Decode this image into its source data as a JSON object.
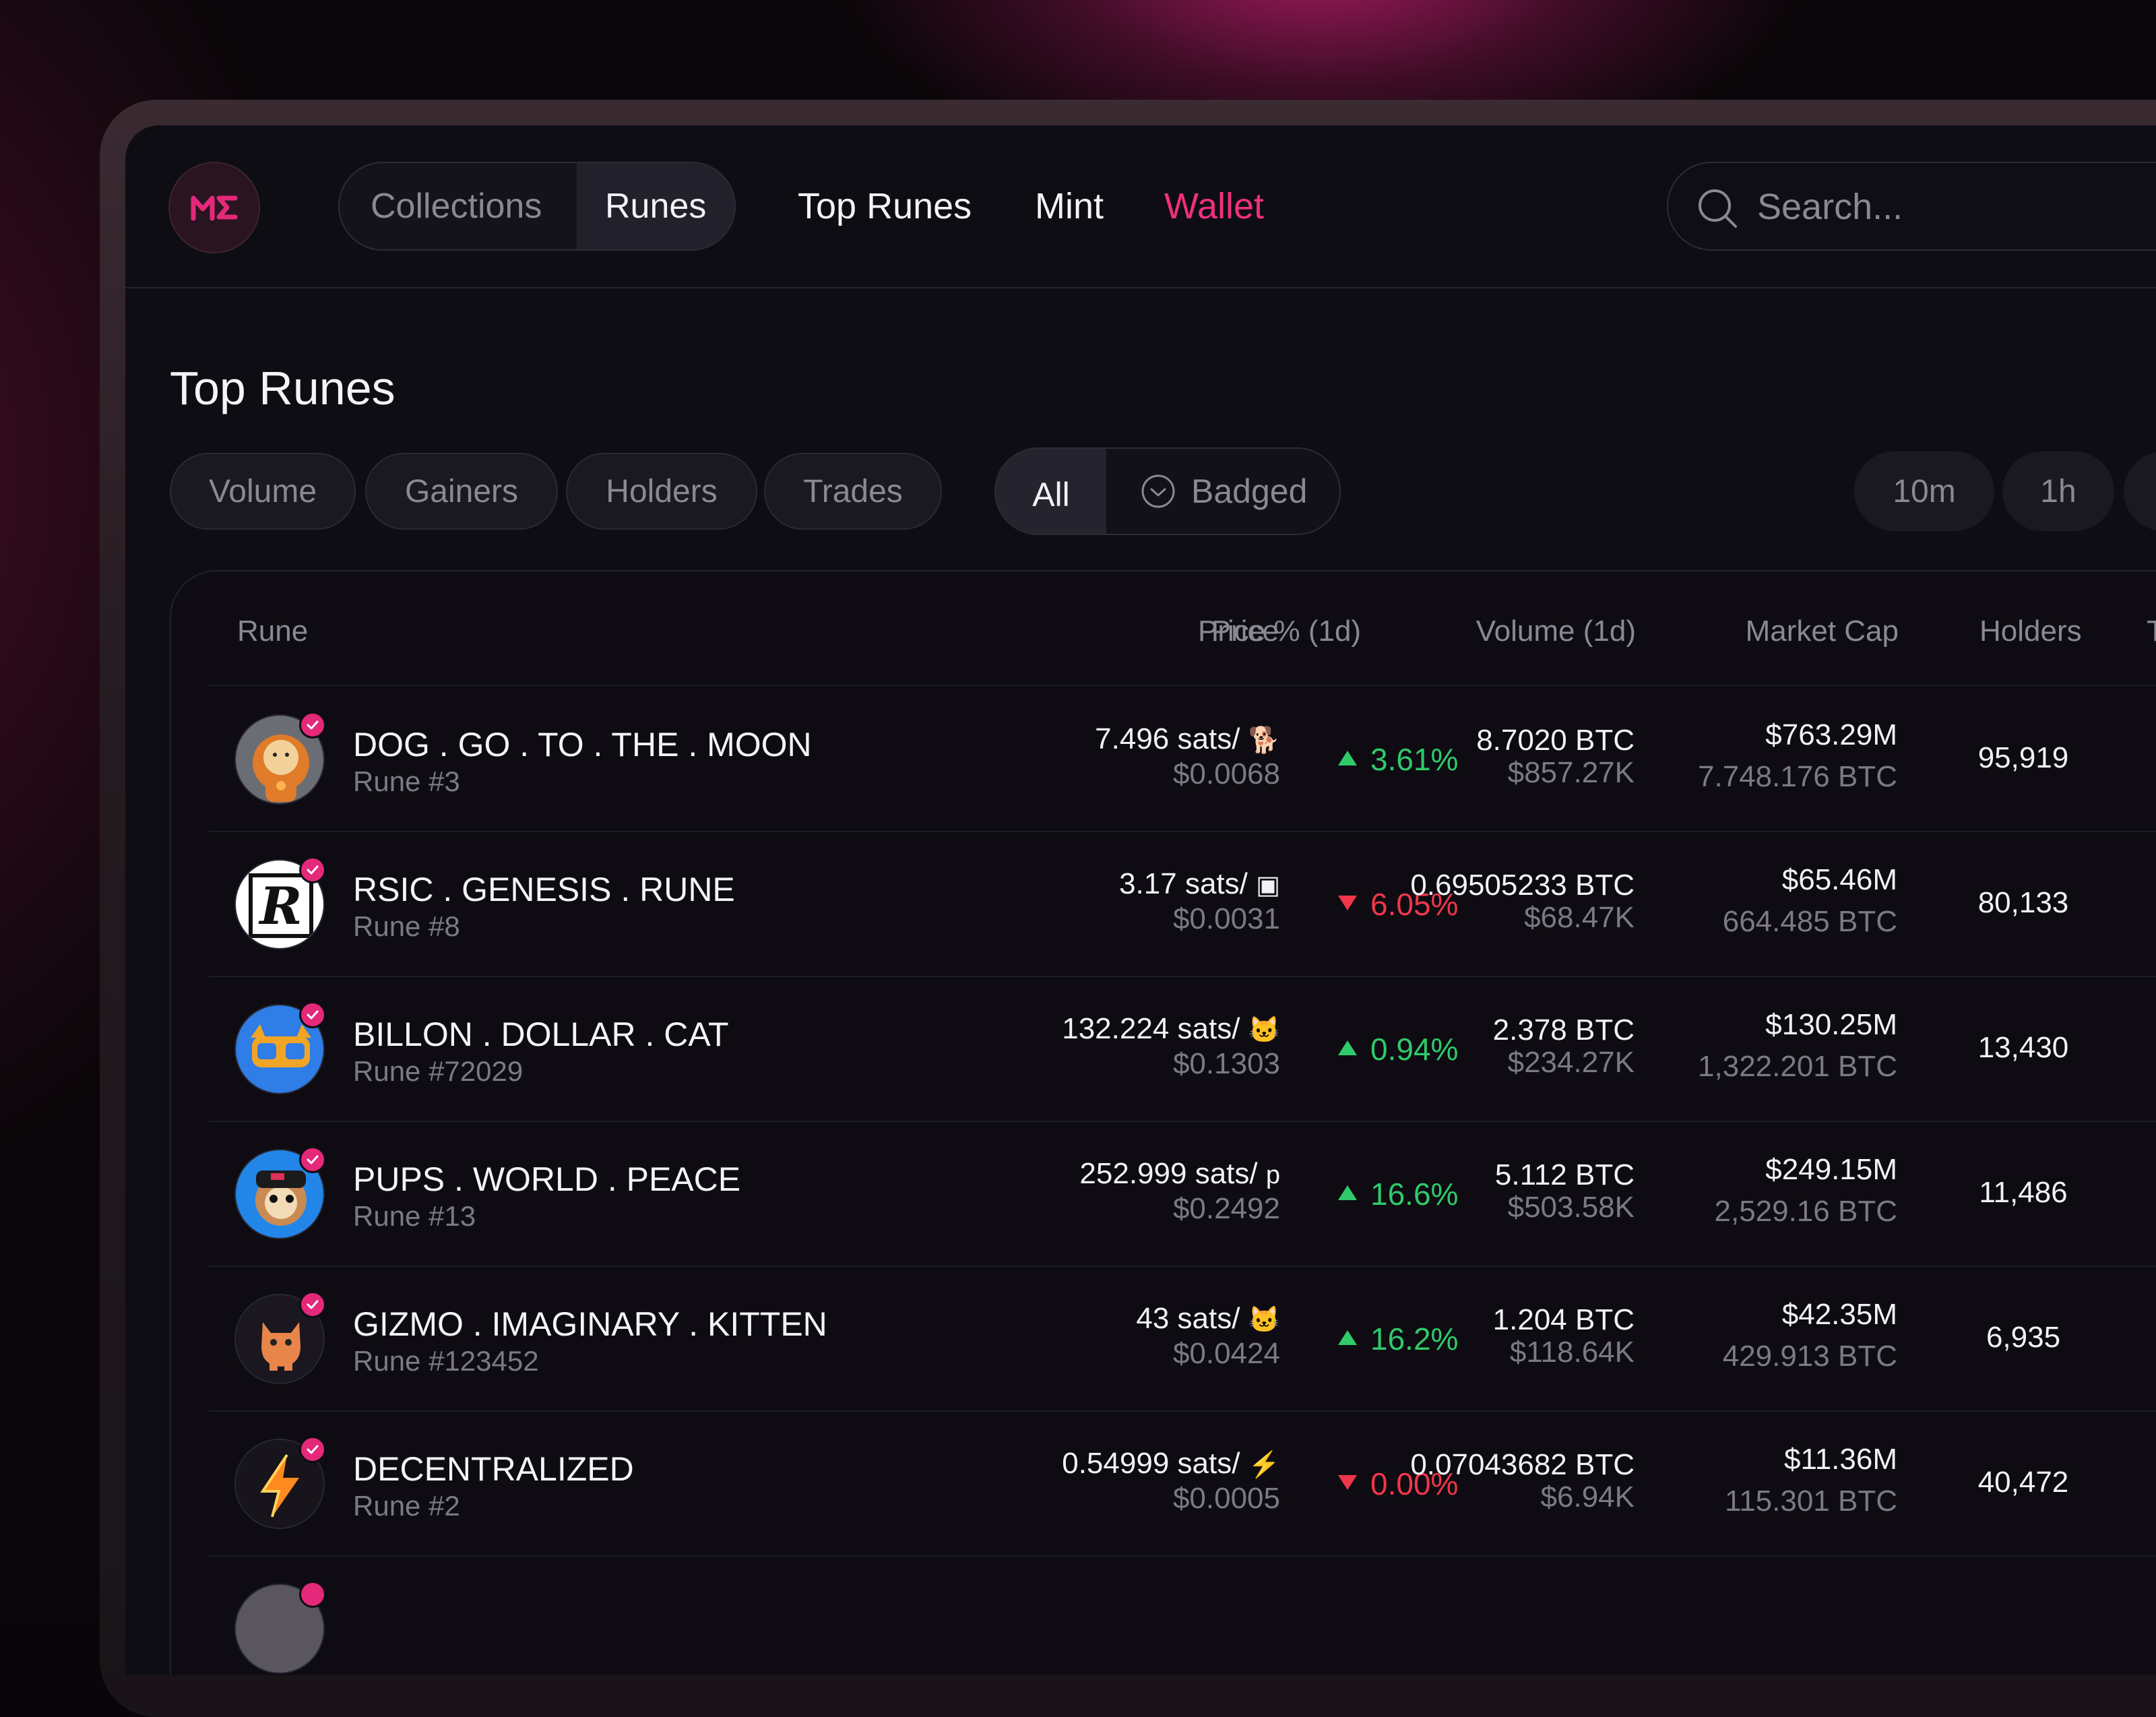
{
  "nav": {
    "segments": [
      "Collections",
      "Runes"
    ],
    "links": [
      "Top Runes",
      "Mint",
      "Wallet"
    ],
    "search_placeholder": "Search..."
  },
  "page_title": "Top Runes",
  "filters": {
    "sort_chips": [
      "Volume",
      "Gainers",
      "Holders",
      "Trades"
    ],
    "toggle": {
      "all": "All",
      "badged": "Badged"
    },
    "time_chips": [
      "10m",
      "1h"
    ]
  },
  "table": {
    "headers": {
      "rune": "Rune",
      "price": "Price",
      "price_pct": "Price % (1d)",
      "volume": "Volume (1d)",
      "market_cap": "Market Cap",
      "holders": "Holders",
      "extra": "T"
    },
    "rows": [
      {
        "name": "DOG . GO . TO . THE . MOON",
        "number": "Rune #3",
        "price_sats": "7.496 sats/",
        "price_symbol": "🐕",
        "price_usd": "$0.0068",
        "pct": "3.61%",
        "direction": "up",
        "vol_btc": "8.7020 BTC",
        "vol_usd": "$857.27K",
        "mcap_usd": "$763.29M",
        "mcap_btc": "7.748.176 BTC",
        "holders": "95,919",
        "avatar": "dog-avatar"
      },
      {
        "name": "RSIC . GENESIS . RUNE",
        "number": "Rune #8",
        "price_sats": "3.17 sats/",
        "price_symbol": "▣",
        "price_usd": "$0.0031",
        "pct": "6.05%",
        "direction": "down",
        "vol_btc": "0.69505233 BTC",
        "vol_usd": "$68.47K",
        "mcap_usd": "$65.46M",
        "mcap_btc": "664.485 BTC",
        "holders": "80,133",
        "avatar": "rsic-avatar"
      },
      {
        "name": "BILLON . DOLLAR . CAT",
        "number": "Rune #72029",
        "price_sats": "132.224 sats/",
        "price_symbol": "🐱",
        "price_usd": "$0.1303",
        "pct": "0.94%",
        "direction": "up",
        "vol_btc": "2.378 BTC",
        "vol_usd": "$234.27K",
        "mcap_usd": "$130.25M",
        "mcap_btc": "1,322.201 BTC",
        "holders": "13,430",
        "avatar": "cat-avatar"
      },
      {
        "name": "PUPS . WORLD . PEACE",
        "number": "Rune #13",
        "price_sats": "252.999 sats/",
        "price_symbol": "p",
        "price_usd": "$0.2492",
        "pct": "16.6%",
        "direction": "up",
        "vol_btc": "5.112 BTC",
        "vol_usd": "$503.58K",
        "mcap_usd": "$249.15M",
        "mcap_btc": "2,529.16 BTC",
        "holders": "11,486",
        "avatar": "pups-avatar"
      },
      {
        "name": "GIZMO . IMAGINARY . KITTEN",
        "number": "Rune #123452",
        "price_sats": "43 sats/",
        "price_symbol": "🐱",
        "price_usd": "$0.0424",
        "pct": "16.2%",
        "direction": "up",
        "vol_btc": "1.204 BTC",
        "vol_usd": "$118.64K",
        "mcap_usd": "$42.35M",
        "mcap_btc": "429.913 BTC",
        "holders": "6,935",
        "avatar": "kitten-avatar"
      },
      {
        "name": "DECENTRALIZED",
        "number": "Rune #2",
        "price_sats": "0.54999 sats/",
        "price_symbol": "⚡",
        "price_usd": "$0.0005",
        "pct": "0.00%",
        "direction": "down",
        "vol_btc": "0.07043682 BTC",
        "vol_usd": "$6.94K",
        "mcap_usd": "$11.36M",
        "mcap_btc": "115.301 BTC",
        "holders": "40,472",
        "avatar": "lightning-avatar"
      }
    ]
  },
  "colors": {
    "accent": "#f0307f",
    "up": "#2fca6a",
    "down": "#f0364a",
    "background": "#0f0d14"
  }
}
